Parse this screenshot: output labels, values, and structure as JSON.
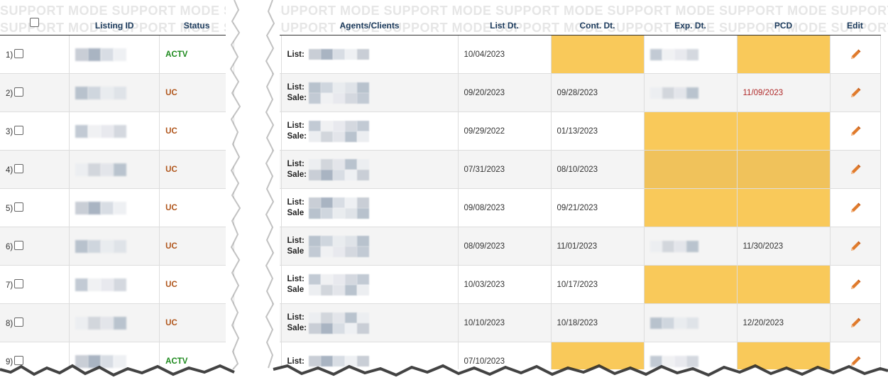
{
  "watermark": "SUPPORT MODE",
  "left_headers": {
    "listing_id": "Listing ID",
    "status": "Status"
  },
  "right_headers": {
    "agents": "Agents/Clients",
    "list_dt": "List Dt.",
    "cont_dt": "Cont. Dt.",
    "exp_dt": "Exp. Dt.",
    "pcd": "PCD",
    "edit": "Edit"
  },
  "rows": [
    {
      "num": "1)",
      "status": "ACTV",
      "agent_labels": [
        "List:"
      ],
      "list_dt": "10/04/2023",
      "cont_dt": "",
      "exp_dt": "",
      "pcd": "",
      "cont_hl": true,
      "exp_hl": false,
      "pcd_hl": true,
      "pcd_red": false
    },
    {
      "num": "2)",
      "status": "UC",
      "agent_labels": [
        "List:",
        "Sale:"
      ],
      "list_dt": "09/20/2023",
      "cont_dt": "09/28/2023",
      "exp_dt": "",
      "pcd": "11/09/2023",
      "cont_hl": false,
      "exp_hl": false,
      "pcd_hl": false,
      "pcd_red": true
    },
    {
      "num": "3)",
      "status": "UC",
      "agent_labels": [
        "List:",
        "Sale:"
      ],
      "list_dt": "09/29/2022",
      "cont_dt": "01/13/2023",
      "exp_dt": "",
      "pcd": "",
      "cont_hl": false,
      "exp_hl": true,
      "pcd_hl": true,
      "pcd_red": false
    },
    {
      "num": "4)",
      "status": "UC",
      "agent_labels": [
        "List:",
        "Sale:"
      ],
      "list_dt": "07/31/2023",
      "cont_dt": "08/10/2023",
      "exp_dt": "",
      "pcd": "",
      "cont_hl": false,
      "exp_hl": true,
      "pcd_hl": true,
      "pcd_red": false
    },
    {
      "num": "5)",
      "status": "UC",
      "agent_labels": [
        "List:",
        "Sale"
      ],
      "list_dt": "09/08/2023",
      "cont_dt": "09/21/2023",
      "exp_dt": "",
      "pcd": "",
      "cont_hl": false,
      "exp_hl": true,
      "pcd_hl": true,
      "pcd_red": false
    },
    {
      "num": "6)",
      "status": "UC",
      "agent_labels": [
        "List:",
        "Sale"
      ],
      "list_dt": "08/09/2023",
      "cont_dt": "11/01/2023",
      "exp_dt": "",
      "pcd": "11/30/2023",
      "cont_hl": false,
      "exp_hl": false,
      "pcd_hl": false,
      "pcd_red": false
    },
    {
      "num": "7)",
      "status": "UC",
      "agent_labels": [
        "List:",
        "Sale"
      ],
      "list_dt": "10/03/2023",
      "cont_dt": "10/17/2023",
      "exp_dt": "",
      "pcd": "",
      "cont_hl": false,
      "exp_hl": true,
      "pcd_hl": true,
      "pcd_red": false
    },
    {
      "num": "8)",
      "status": "UC",
      "agent_labels": [
        "List:",
        "Sale:"
      ],
      "list_dt": "10/10/2023",
      "cont_dt": "10/18/2023",
      "exp_dt": "",
      "pcd": "12/20/2023",
      "cont_hl": false,
      "exp_hl": false,
      "pcd_hl": false,
      "pcd_red": false
    },
    {
      "num": "9)",
      "status": "ACTV",
      "agent_labels": [
        "List:"
      ],
      "list_dt": "07/10/2023",
      "cont_dt": "",
      "exp_dt": "",
      "pcd": "",
      "cont_hl": true,
      "exp_hl": false,
      "pcd_hl": true,
      "pcd_red": false
    }
  ],
  "colors": {
    "highlight": "#f9c95a",
    "status_actv": "#1e8a1e",
    "status_uc": "#b0561c",
    "pcd_red": "#b02a2a",
    "header_text": "#1b3a5c",
    "edit_icon": "#e07b2c"
  },
  "icons": {
    "edit": "pencil-icon",
    "select": "checkbox"
  }
}
